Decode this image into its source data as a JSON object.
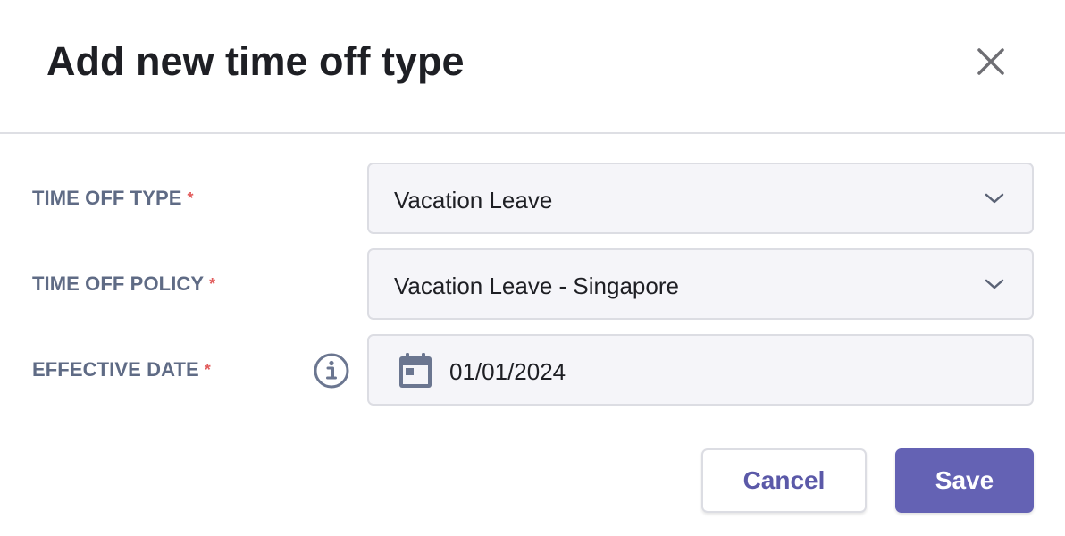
{
  "dialog": {
    "title": "Add new time off type",
    "close_icon": "close-icon"
  },
  "form": {
    "time_off_type": {
      "label": "TIME OFF TYPE",
      "required_mark": "*",
      "value": "Vacation Leave",
      "icon": "chevron-down-icon"
    },
    "time_off_policy": {
      "label": "TIME OFF POLICY",
      "required_mark": "*",
      "value": "Vacation Leave - Singapore",
      "icon": "chevron-down-icon"
    },
    "effective_date": {
      "label": "EFFECTIVE DATE",
      "required_mark": "*",
      "value": "01/01/2024",
      "info_icon": "info-icon",
      "calendar_icon": "calendar-icon"
    }
  },
  "footer": {
    "cancel_label": "Cancel",
    "save_label": "Save"
  },
  "colors": {
    "title": "#1e1f24",
    "label": "#5f6b85",
    "required": "#e25c5c",
    "field_background": "#f5f5f9",
    "field_border": "#dcdde3",
    "primary": "#6462b4",
    "cancel_text": "#5b59a8",
    "icon": "#6b7690"
  }
}
